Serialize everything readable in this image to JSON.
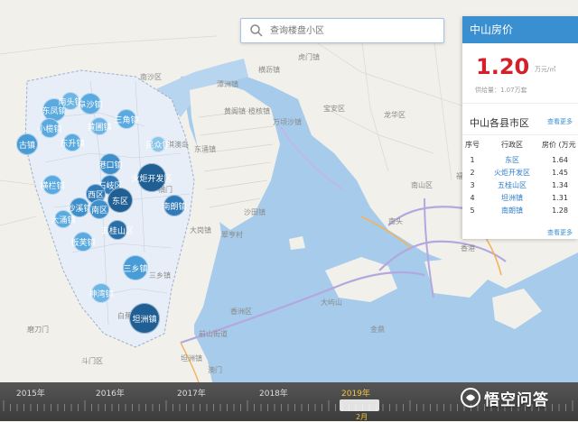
{
  "search": {
    "placeholder": "查询楼盘小区"
  },
  "panel": {
    "title": "中山房价",
    "price_value": "1.20",
    "price_unit": "万元/㎡",
    "supply": "供给量：1.07万套",
    "more_label": "查看更多",
    "districts_title": "中山各县市区",
    "columns": [
      "序号",
      "行政区",
      "房价 (万元"
    ],
    "rows": [
      {
        "no": "1",
        "name": "东区",
        "price": "1.64"
      },
      {
        "no": "2",
        "name": "火炬开发区",
        "price": "1.45"
      },
      {
        "no": "3",
        "name": "五桂山区",
        "price": "1.34"
      },
      {
        "no": "4",
        "name": "坦洲镇",
        "price": "1.31"
      },
      {
        "no": "5",
        "name": "南朗镇",
        "price": "1.28"
      }
    ],
    "more_label_2": "查看更多"
  },
  "bubbles": [
    {
      "label": "东凤镇"
    },
    {
      "label": "南头镇"
    },
    {
      "label": "小榄镇"
    },
    {
      "label": "阜沙镇"
    },
    {
      "label": "黄圃镇"
    },
    {
      "label": "三角镇"
    },
    {
      "label": "东升镇"
    },
    {
      "label": "民众镇"
    },
    {
      "label": "古镇"
    },
    {
      "label": "港口镇"
    },
    {
      "label": "横栏镇"
    },
    {
      "label": "石岐区"
    },
    {
      "label": "火炬开发区"
    },
    {
      "label": "西区"
    },
    {
      "label": "东区"
    },
    {
      "label": "沙溪镇"
    },
    {
      "label": "南区"
    },
    {
      "label": "南朗镇"
    },
    {
      "label": "大涌镇"
    },
    {
      "label": "五桂山区"
    },
    {
      "label": "板芙镇"
    },
    {
      "label": "三乡镇"
    },
    {
      "label": "神湾镇"
    },
    {
      "label": "坦洲镇"
    }
  ],
  "places": [
    "南沙区",
    "潭洲镇",
    "东涌镇",
    "大岗镇",
    "黄阁镇",
    "榄核镇",
    "横沥镇",
    "万顷沙镇",
    "长安镇",
    "虎门镇",
    "沙田镇",
    "宝安区",
    "龙华区",
    "南山区",
    "福田区",
    "香洲区",
    "斗门区",
    "磨刀门",
    "前山街道",
    "坦洲镇",
    "白蕉镇",
    "翠亨村",
    "三乡镇",
    "横门",
    "淇澳岛",
    "南头",
    "大屿山",
    "香港",
    "金鼎",
    "澳门"
  ],
  "timeline": {
    "years": [
      "2015年",
      "2016年",
      "2017年",
      "2018年",
      "2019年"
    ],
    "active_year": "2019年",
    "month": "2月"
  },
  "watermark": {
    "text": "悟空问答"
  },
  "colors": {
    "panel_header": "#3a8fd1",
    "price": "#d3202a",
    "water": "#a7cbea",
    "bubble_light": "#5aa9df",
    "bubble_dark": "#1f5f94"
  }
}
